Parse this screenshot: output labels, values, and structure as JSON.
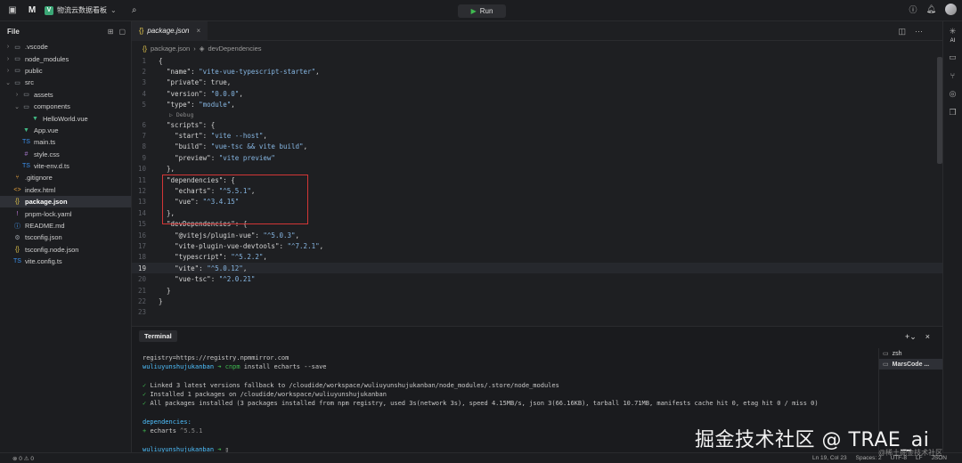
{
  "topbar": {
    "project_name": "物流云数据看板",
    "run_label": "Run"
  },
  "sidebar": {
    "title": "File",
    "items": [
      {
        "label": ".vscode",
        "kind": "folder",
        "depth": 0,
        "open": false
      },
      {
        "label": "node_modules",
        "kind": "folder",
        "depth": 0,
        "open": false
      },
      {
        "label": "public",
        "kind": "folder",
        "depth": 0,
        "open": false
      },
      {
        "label": "src",
        "kind": "folder",
        "depth": 0,
        "open": true
      },
      {
        "label": "assets",
        "kind": "folder",
        "depth": 1,
        "open": false
      },
      {
        "label": "components",
        "kind": "folder",
        "depth": 1,
        "open": true
      },
      {
        "label": "HelloWorld.vue",
        "kind": "vue",
        "depth": 2
      },
      {
        "label": "App.vue",
        "kind": "vue",
        "depth": 1
      },
      {
        "label": "main.ts",
        "kind": "ts",
        "depth": 1
      },
      {
        "label": "style.css",
        "kind": "css",
        "depth": 1
      },
      {
        "label": "vite-env.d.ts",
        "kind": "ts",
        "depth": 1
      },
      {
        "label": ".gitignore",
        "kind": "git",
        "depth": 0
      },
      {
        "label": "index.html",
        "kind": "html",
        "depth": 0
      },
      {
        "label": "package.json",
        "kind": "json",
        "depth": 0,
        "selected": true
      },
      {
        "label": "pnpm-lock.yaml",
        "kind": "yaml",
        "depth": 0
      },
      {
        "label": "README.md",
        "kind": "md",
        "depth": 0
      },
      {
        "label": "tsconfig.json",
        "kind": "tsconfig",
        "depth": 0
      },
      {
        "label": "tsconfig.node.json",
        "kind": "json",
        "depth": 0
      },
      {
        "label": "vite.config.ts",
        "kind": "ts",
        "depth": 0
      }
    ]
  },
  "editor": {
    "tab_label": "package.json",
    "breadcrumb": [
      "package.json",
      "devDependencies"
    ],
    "current_line": 19,
    "code_lens": "Debug",
    "lines": [
      {
        "n": "1",
        "text": "{"
      },
      {
        "n": "2",
        "text": "  \"name\": \"vite-vue-typescript-starter\","
      },
      {
        "n": "3",
        "text": "  \"private\": true,"
      },
      {
        "n": "4",
        "text": "  \"version\": \"0.0.0\","
      },
      {
        "n": "5",
        "text": "  \"type\": \"module\","
      },
      {
        "n": "",
        "text": "LENS"
      },
      {
        "n": "6",
        "text": "  \"scripts\": {"
      },
      {
        "n": "7",
        "text": "    \"start\": \"vite --host\","
      },
      {
        "n": "8",
        "text": "    \"build\": \"vue-tsc && vite build\","
      },
      {
        "n": "9",
        "text": "    \"preview\": \"vite preview\""
      },
      {
        "n": "10",
        "text": "  },"
      },
      {
        "n": "11",
        "text": "  \"dependencies\": {"
      },
      {
        "n": "12",
        "text": "    \"echarts\": \"^5.5.1\","
      },
      {
        "n": "13",
        "text": "    \"vue\": \"^3.4.15\""
      },
      {
        "n": "14",
        "text": "  },"
      },
      {
        "n": "15",
        "text": "  \"devDependencies\": {"
      },
      {
        "n": "16",
        "text": "    \"@vitejs/plugin-vue\": \"^5.0.3\","
      },
      {
        "n": "17",
        "text": "    \"vite-plugin-vue-devtools\": \"^7.2.1\","
      },
      {
        "n": "18",
        "text": "    \"typescript\": \"^5.2.2\","
      },
      {
        "n": "19",
        "text": "    \"vite\": \"^5.0.12\","
      },
      {
        "n": "20",
        "text": "    \"vue-tsc\": \"^2.0.21\""
      },
      {
        "n": "21",
        "text": "  }"
      },
      {
        "n": "22",
        "text": "}"
      },
      {
        "n": "23",
        "text": ""
      }
    ]
  },
  "right_bar": {
    "ai_label": "AI"
  },
  "terminal": {
    "tab_label": "Terminal",
    "lines": [
      {
        "parts": [
          {
            "t": "registry=https://registry.npmmirror.com",
            "c": ""
          }
        ]
      },
      {
        "parts": [
          {
            "t": "wuliuyunshujukanban ",
            "c": "cy"
          },
          {
            "t": "➜ ",
            "c": "green"
          },
          {
            "t": "cnpm",
            "c": "green"
          },
          {
            "t": " install echarts --save",
            "c": ""
          }
        ]
      },
      {
        "parts": [
          {
            "t": "",
            "c": ""
          }
        ]
      },
      {
        "parts": [
          {
            "t": "✓ ",
            "c": "green"
          },
          {
            "t": "Linked 3 latest versions fallback to /cloudide/workspace/wuliuyunshujukanban/node_modules/.store/node_modules",
            "c": ""
          }
        ]
      },
      {
        "parts": [
          {
            "t": "✓ ",
            "c": "green"
          },
          {
            "t": "Installed 1 packages on /cloudide/workspace/wuliuyunshujukanban",
            "c": ""
          }
        ]
      },
      {
        "parts": [
          {
            "t": "✓ ",
            "c": "green"
          },
          {
            "t": "All packages installed (3 packages installed from npm registry, used 3s(network 3s), speed 4.15MB/s, json 3(66.16KB), tarball 10.71MB, manifests cache hit 0, etag hit 0 / miss 0)",
            "c": ""
          }
        ]
      },
      {
        "parts": [
          {
            "t": "",
            "c": ""
          }
        ]
      },
      {
        "parts": [
          {
            "t": "dependencies:",
            "c": "cy"
          }
        ]
      },
      {
        "parts": [
          {
            "t": "+ ",
            "c": "green"
          },
          {
            "t": "echarts ",
            "c": ""
          },
          {
            "t": "^5.5.1",
            "c": "dim"
          }
        ]
      },
      {
        "parts": [
          {
            "t": "",
            "c": ""
          }
        ]
      },
      {
        "parts": [
          {
            "t": "wuliuyunshujukanban ",
            "c": "cy"
          },
          {
            "t": "➜ ",
            "c": "green"
          },
          {
            "t": "▯",
            "c": ""
          }
        ]
      }
    ],
    "sessions": [
      {
        "label": "zsh",
        "selected": false
      },
      {
        "label": "MarsCode ...",
        "selected": true
      }
    ]
  },
  "statusbar": {
    "problems": "0",
    "warnings": "0",
    "position": "Ln 19, Col 23",
    "spaces": "Spaces: 2",
    "encoding": "UTF-8",
    "eol": "LF",
    "language": "JSON"
  },
  "watermark": {
    "main": "掘金技术社区 @ TRAE_ai",
    "sub": "@稀土掘金技术社区"
  }
}
